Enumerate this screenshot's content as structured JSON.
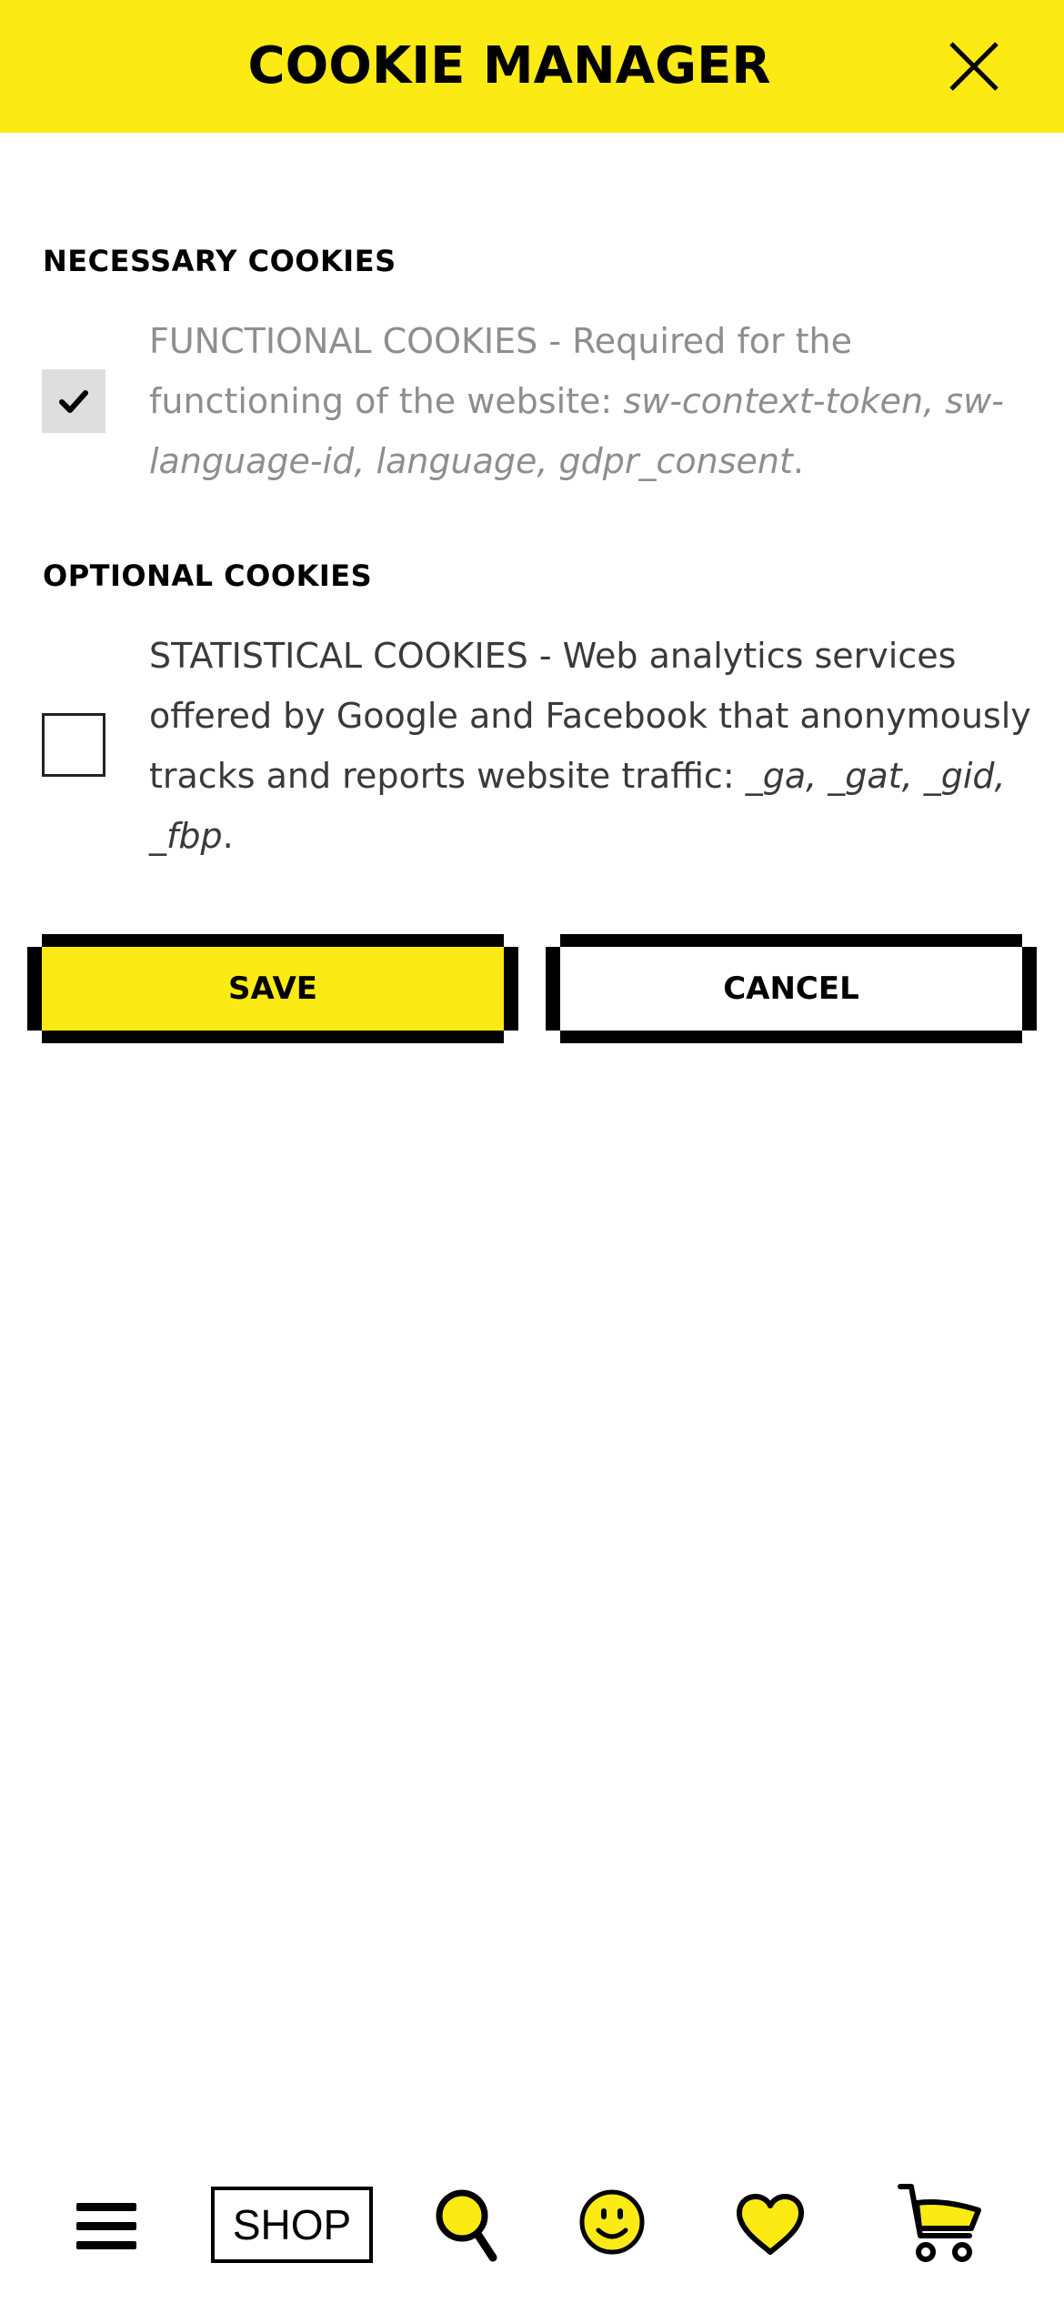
{
  "header": {
    "title": "COOKIE MANAGER",
    "close_icon": "close-icon"
  },
  "necessary": {
    "heading": "NECESSARY COOKIES",
    "checked": true,
    "label": "FUNCTIONAL COOKIES - Required for the functioning of the website: ",
    "cookies": "sw-context-token, sw-language-id, language, gdpr_consent",
    "suffix": "."
  },
  "optional": {
    "heading": "OPTIONAL COOKIES",
    "checked": false,
    "label": "STATISTICAL COOKIES - Web analytics services offered by Google and Facebook that anonymously tracks and reports website traffic: ",
    "cookies": "_ga, _gat, _gid, _fbp",
    "suffix": "."
  },
  "buttons": {
    "save_label": "SAVE",
    "cancel_label": "CANCEL"
  },
  "bottom_nav": {
    "shop_label": "SHOP",
    "icons": [
      "menu-icon",
      "search-icon",
      "smiley-icon",
      "heart-icon",
      "cart-icon"
    ]
  },
  "colors": {
    "accent_yellow": "#fcea14",
    "black": "#000000",
    "muted_text": "#8e8e8e",
    "body_text": "#3a3a3a",
    "disabled_checkbox": "#dedede"
  }
}
